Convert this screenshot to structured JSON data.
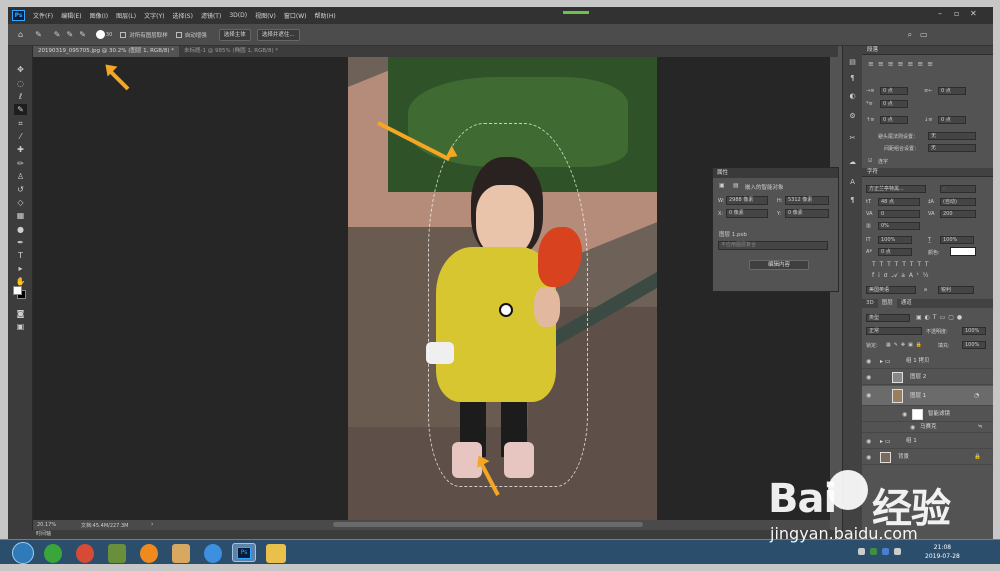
{
  "app": {
    "logo": "Ps",
    "menu": [
      "文件(F)",
      "编辑(E)",
      "图像(I)",
      "图层(L)",
      "文字(Y)",
      "选择(S)",
      "滤镜(T)",
      "3D(D)",
      "视图(V)",
      "窗口(W)",
      "帮助(H)"
    ]
  },
  "options": {
    "brush_size": "30",
    "sample_all_layers": "对所有图层取样",
    "auto_enhance": "自动增强",
    "select_subject": "选择主体",
    "select_and_mask": "选择并遮住..."
  },
  "tabs": [
    {
      "label": "20190319_095705.jpg @ 30.2% (图层 1, RGB/8) *",
      "active": true
    },
    {
      "label": "未标题-1 @ 985% (椭圆 1, RGB/8) *",
      "active": false
    }
  ],
  "status": {
    "zoom": "20.17%",
    "doc": "文档:45.4M/227.3M",
    "timeline": "时间轴"
  },
  "properties": {
    "panel_title": "属性",
    "object_type": "嵌入的智能对象",
    "w_label": "W:",
    "w_value": "2988 像素",
    "h_label": "H:",
    "h_value": "5312 像素",
    "x_label": "X:",
    "x_value": "0 像素",
    "y_label": "Y:",
    "y_value": "0 像素",
    "file": "图层 1.psb",
    "layer_comp_placeholder": "不应用图层复合",
    "edit_button": "编辑内容"
  },
  "paragraph": {
    "title": "段落",
    "fields": [
      "0 点",
      "0 点",
      "0 点",
      "0 点",
      "0 点"
    ],
    "hyphenation_label": "避头尾法则设置：",
    "hyphenation_value": "无",
    "spacing_label": "间距组合设置：",
    "spacing_value": "无",
    "hyphenate": "连字"
  },
  "character": {
    "title": "字符",
    "font": "方正兰亭特黑...",
    "size": "48 点",
    "leading": "(自动)",
    "tracking": "200",
    "kerning": "0%",
    "vscale": "100%",
    "hscale": "100%",
    "baseline": "0 点",
    "color_label": "颜色:",
    "language": "美国英语",
    "aa": "锐利",
    "aa_prefix": "a",
    "va_label": "VA",
    "va_value": "0"
  },
  "layers": {
    "tabs": [
      "3D",
      "图层",
      "通道"
    ],
    "filter": "类型",
    "blend": "正常",
    "opacity_label": "不透明度:",
    "opacity": "100%",
    "lock_label": "锁定:",
    "fill_label": "填充:",
    "fill": "100%",
    "items": [
      {
        "name": "组 1 拷贝",
        "kind": "group"
      },
      {
        "name": "图层 2",
        "kind": "layer"
      },
      {
        "name": "图层 1",
        "kind": "smart",
        "selected": true
      },
      {
        "name": "智能滤镜",
        "kind": "filter"
      },
      {
        "name": "马赛克",
        "kind": "effect"
      },
      {
        "name": "组 1",
        "kind": "group"
      },
      {
        "name": "背景",
        "kind": "bg"
      }
    ]
  },
  "taskbar": {
    "time": "21:08",
    "date": "2019-07-28"
  },
  "watermark": {
    "brand": "Bai",
    "brand2": "经验",
    "url": "jingyan.baidu.com"
  }
}
